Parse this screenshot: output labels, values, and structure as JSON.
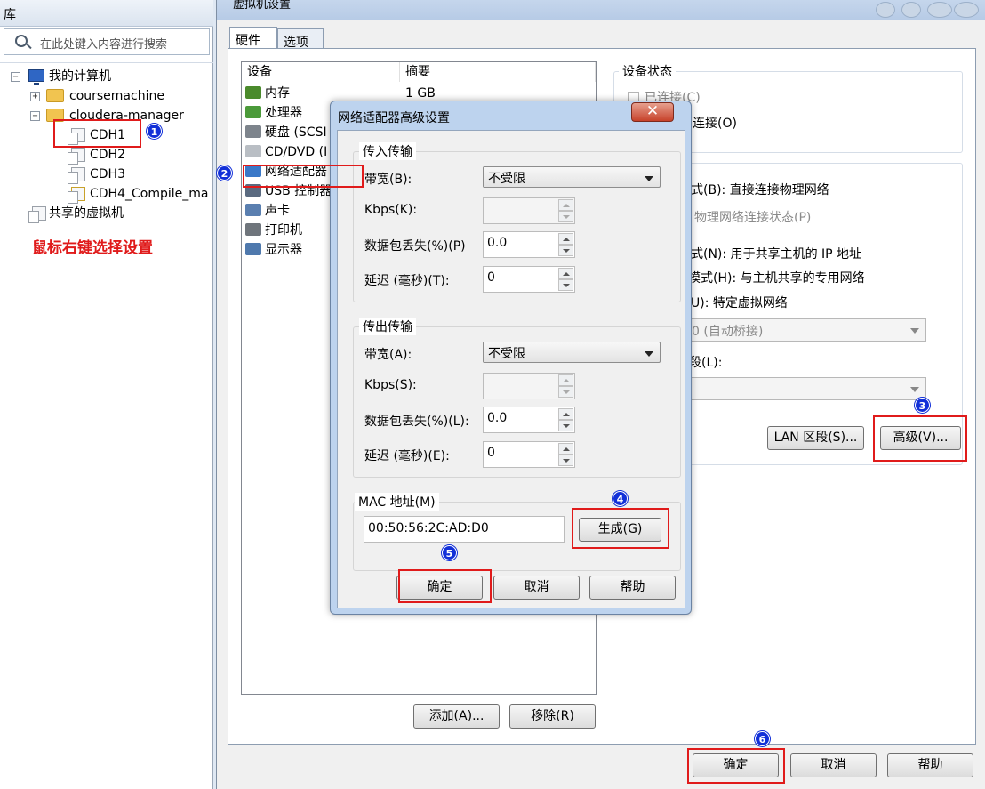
{
  "library": {
    "title": "库",
    "search_placeholder": "在此处键入内容进行搜索",
    "tree": {
      "root": "我的计算机",
      "folder1": "coursemachine",
      "folder2": "cloudera-manager",
      "vms": [
        "CDH1",
        "CDH2",
        "CDH3",
        "CDH4_Compile_ma"
      ],
      "shared": "共享的虚拟机"
    },
    "note": "鼠标右键选择设置"
  },
  "main_dialog": {
    "title": "虚拟机设置",
    "tabs": [
      "硬件",
      "选项"
    ],
    "device_list": {
      "headers": [
        "设备",
        "摘要"
      ],
      "devices": [
        {
          "name": "内存",
          "summary": "1 GB",
          "icon": "memory-icon",
          "color": "#4a8a2c"
        },
        {
          "name": "处理器",
          "summary": "",
          "icon": "cpu-icon",
          "color": "#4b9a3a"
        },
        {
          "name": "硬盘 (SCSI",
          "summary": "",
          "icon": "hdd-icon",
          "color": "#7d848c"
        },
        {
          "name": "CD/DVD (I",
          "summary": "",
          "icon": "cd-icon",
          "color": "#b9bec4"
        },
        {
          "name": "网络适配器",
          "summary": "",
          "icon": "network-icon",
          "color": "#3a78c8"
        },
        {
          "name": "USB 控制器",
          "summary": "",
          "icon": "usb-icon",
          "color": "#5a6a80"
        },
        {
          "name": "声卡",
          "summary": "",
          "icon": "speaker-icon",
          "color": "#5a7fb0"
        },
        {
          "name": "打印机",
          "summary": "",
          "icon": "printer-icon",
          "color": "#6f757c"
        },
        {
          "name": "显示器",
          "summary": "",
          "icon": "monitor-icon",
          "color": "#4f79ad"
        }
      ]
    },
    "add_button": "添加(A)...",
    "remove_button": "移除(R)",
    "device_status": {
      "title": "设备状态",
      "connected": "已连接(C)",
      "connect_on_power": "连接(O)"
    },
    "net": {
      "bridged": "式(B): 直接连接物理网络",
      "replicate": "物理网络连接状态(P)",
      "nat": "式(N): 用于共享主机的 IP 地址",
      "hostonly": "模式(H): 与主机共享的专用网络",
      "custom": "U): 特定虚拟网络",
      "custom_select": "0 (自动桥接)",
      "lan_label": "段(L):",
      "lan_button": "LAN 区段(S)...",
      "advanced_button": "高级(V)..."
    },
    "ok": "确定",
    "cancel": "取消",
    "help": "帮助"
  },
  "advanced_dialog": {
    "title": "网络适配器高级设置",
    "incoming": {
      "title": "传入传输",
      "bandwidth_label": "带宽(B):",
      "bandwidth_value": "不受限",
      "kbps_label": "Kbps(K):",
      "loss_label": "数据包丢失(%)(P)",
      "loss_value": "0.0",
      "latency_label": "延迟 (毫秒)(T):",
      "latency_value": "0"
    },
    "outgoing": {
      "title": "传出传输",
      "bandwidth_label": "带宽(A):",
      "bandwidth_value": "不受限",
      "kbps_label": "Kbps(S):",
      "loss_label": "数据包丢失(%)(L):",
      "loss_value": "0.0",
      "latency_label": "延迟 (毫秒)(E):",
      "latency_value": "0"
    },
    "mac_label": "MAC 地址(M)",
    "mac_value": "00:50:56:2C:AD:D0",
    "generate_button": "生成(G)",
    "ok": "确定",
    "cancel": "取消",
    "help": "帮助"
  },
  "annotations": [
    "1",
    "2",
    "3",
    "4",
    "5",
    "6"
  ],
  "colors": {
    "annotation_red": "#e01b1b",
    "badge_blue": "#1230d8",
    "title_bar": "#bdd3ee"
  }
}
